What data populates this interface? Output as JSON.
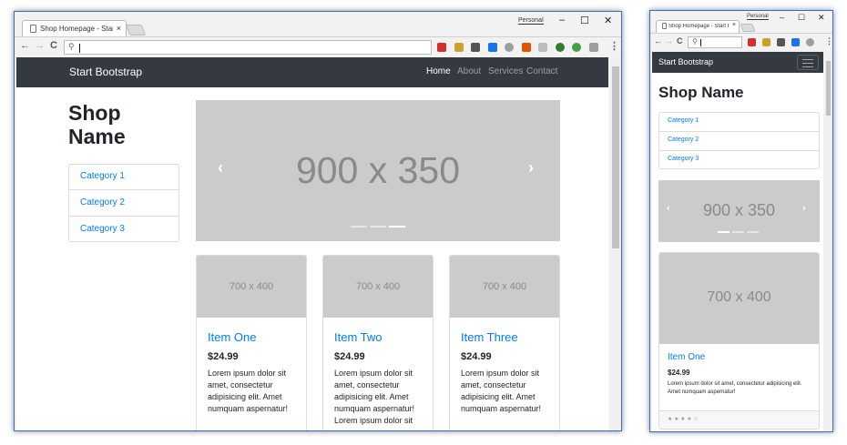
{
  "browser": {
    "tab_title": "Shop Homepage - Start Bootstrap",
    "tab_close": "×",
    "profile": "Personal",
    "minimize": "–",
    "maximize": "☐",
    "close": "✕",
    "back": "←",
    "forward": "→",
    "reload": "C",
    "search_glyph": "🔍",
    "menu": "⋮",
    "extensions": [
      {
        "name": "ext-red",
        "color": "#d32f2f"
      },
      {
        "name": "ext-folder",
        "color": "#c9a227"
      },
      {
        "name": "ext-k",
        "color": "#555555"
      },
      {
        "name": "ext-translate",
        "color": "#1a73e8"
      },
      {
        "name": "ext-circle",
        "color": "#9e9e9e"
      },
      {
        "name": "ext-arc",
        "color": "#e65100"
      },
      {
        "name": "ext-gray",
        "color": "#bdbdbd"
      },
      {
        "name": "ext-green-c",
        "color": "#2e7d32"
      },
      {
        "name": "ext-green-dot",
        "color": "#43a047"
      },
      {
        "name": "ext-puzzle",
        "color": "#9e9e9e"
      }
    ]
  },
  "site": {
    "brand": "Start Bootstrap",
    "nav": [
      "Home",
      "About",
      "Services",
      "Contact"
    ],
    "heading": "Shop Name",
    "categories": [
      "Category 1",
      "Category 2",
      "Category 3"
    ],
    "carousel": {
      "label": "900 x 350",
      "prev": "‹",
      "next": "›",
      "slides": 3,
      "active_slide": 3
    },
    "products": [
      {
        "image": "700 x 400",
        "title": "Item One",
        "price": "$24.99",
        "text": "Lorem ipsum dolor sit amet, consectetur adipisicing elit. Amet numquam aspernatur!"
      },
      {
        "image": "700 x 400",
        "title": "Item Two",
        "price": "$24.99",
        "text": "Lorem ipsum dolor sit amet, consectetur adipisicing elit. Amet numquam aspernatur! Lorem ipsum dolor sit"
      },
      {
        "image": "700 x 400",
        "title": "Item Three",
        "price": "$24.99",
        "text": "Lorem ipsum dolor sit amet, consectetur adipisicing elit. Amet numquam aspernatur!"
      }
    ],
    "rating": "★ ★ ★ ★ ☆",
    "mobile_card_text": "Lorem ipsum dolor sit amet, consectetur adipisicing elit. Amet numquam aspernatur!"
  }
}
